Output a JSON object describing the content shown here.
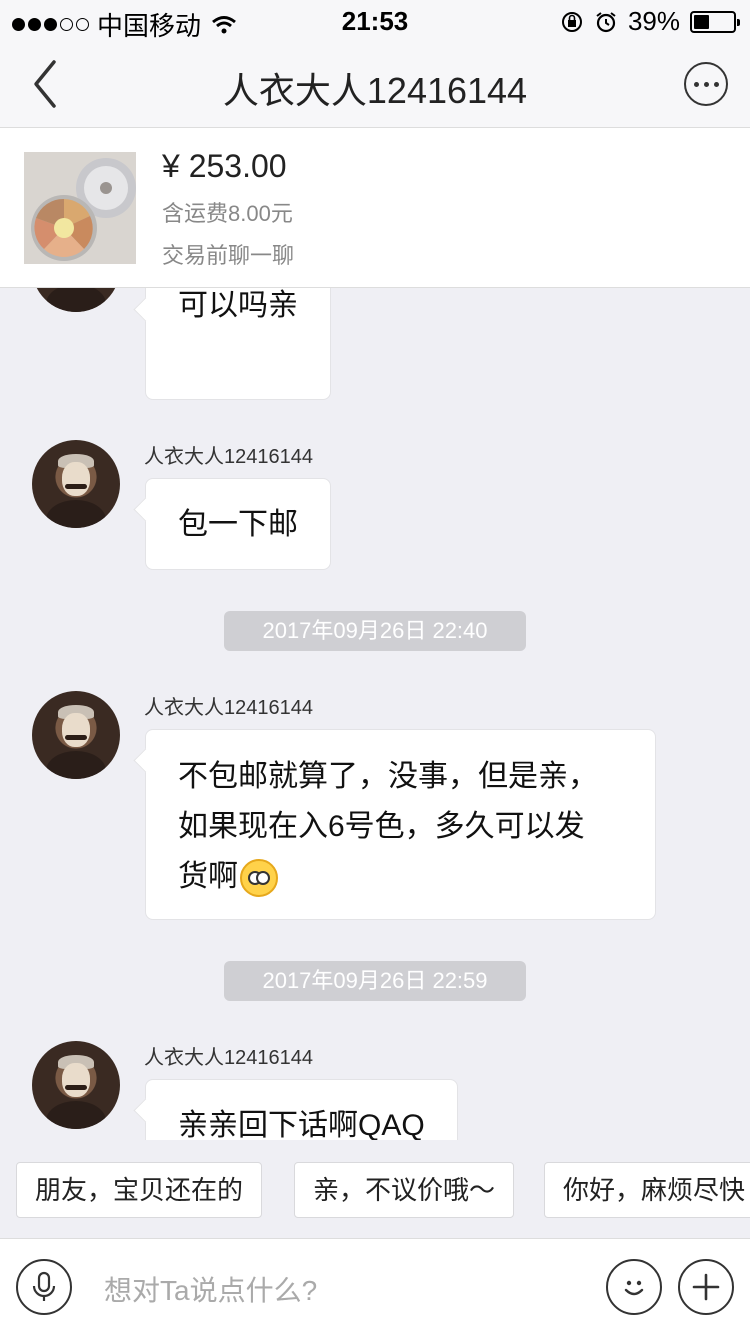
{
  "status_bar": {
    "carrier": "中国移动",
    "time": "21:53",
    "battery": "39%",
    "battery_level": 0.39
  },
  "nav": {
    "title": "人衣大人12416144"
  },
  "product": {
    "price": "¥ 253.00",
    "shipping": "含运费8.00元",
    "chat_before": "交易前聊一聊"
  },
  "chat": {
    "msg1": "可以吗亲",
    "sender2": "人衣大人12416144",
    "msg2": "包一下邮",
    "ts1": "2017年09月26日 22:40",
    "sender3": "人衣大人12416144",
    "msg3_line1": "不包邮就算了，没事，但是亲，",
    "msg3_line2": "如果现在入6号色，多久可以发",
    "msg3_line3": "货啊",
    "ts2": "2017年09月26日 22:59",
    "sender4": "人衣大人12416144",
    "msg4": "亲亲回下话啊QAQ"
  },
  "quick_replies": [
    "朋友，宝贝还在的",
    "亲，不议价哦～",
    "你好，麻烦尽快"
  ],
  "input": {
    "placeholder": "想对Ta说点什么?"
  }
}
